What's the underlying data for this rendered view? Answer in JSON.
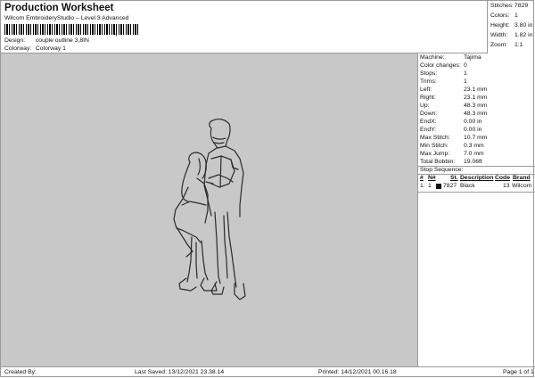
{
  "header": {
    "title": "Production Worksheet",
    "subtitle": "Wilcom EmbroideryStudio – Level 3 Advanced",
    "barcode_suffix": ",",
    "design_label": "Design:",
    "design_value": "couple outline 3,8IN",
    "colorway_label": "Colorway:",
    "colorway_value": "Colorway 1"
  },
  "stats": [
    {
      "label": "Stitches:",
      "value": "7829"
    },
    {
      "label": "Colors:",
      "value": "1"
    },
    {
      "label": "Height:",
      "value": "3.80 in"
    },
    {
      "label": "Width:",
      "value": "1.82 in"
    },
    {
      "label": "Zoom:",
      "value": "1:1"
    }
  ],
  "machine": [
    {
      "label": "Machine:",
      "value": "Tajima"
    },
    {
      "label": "Color changes:",
      "value": "0"
    },
    {
      "label": "Stops:",
      "value": "1"
    },
    {
      "label": "Trims:",
      "value": "1"
    },
    {
      "label": "Left:",
      "value": "23.1 mm"
    },
    {
      "label": "Right:",
      "value": "23.1 mm"
    },
    {
      "label": "Up:",
      "value": "48.3 mm"
    },
    {
      "label": "Down:",
      "value": "48.3 mm"
    },
    {
      "label": "EndX:",
      "value": "0.00 in"
    },
    {
      "label": "EndY:",
      "value": "0.00 in"
    },
    {
      "label": "Max Stitch:",
      "value": "10.7 mm"
    },
    {
      "label": "Min Stitch:",
      "value": "0.3 mm"
    },
    {
      "label": "Max Jump:",
      "value": "7.0 mm"
    },
    {
      "label": "Total Bobbin:",
      "value": "19.06ft"
    }
  ],
  "stop_sequence": {
    "title": "Stop Sequence:",
    "headers": {
      "num": "#",
      "n": "N#",
      "st": "St.",
      "desc": "Description",
      "code": "Code",
      "brand": "Brand"
    },
    "rows": [
      {
        "num": "1.",
        "n": "1",
        "st": "7827",
        "desc": "Black",
        "code": "13",
        "brand": "Wilcom",
        "color": "#111111"
      }
    ]
  },
  "footer": {
    "created": "Created By:",
    "saved": "Last Saved: 13/12/2021 23.38.14",
    "printed": "Printed: 14/12/2021 00.16.18",
    "page": "Page 1 of 1"
  },
  "colors": {
    "canvas_bg": "#c8c8c8",
    "outline": "#2a2a2a"
  }
}
